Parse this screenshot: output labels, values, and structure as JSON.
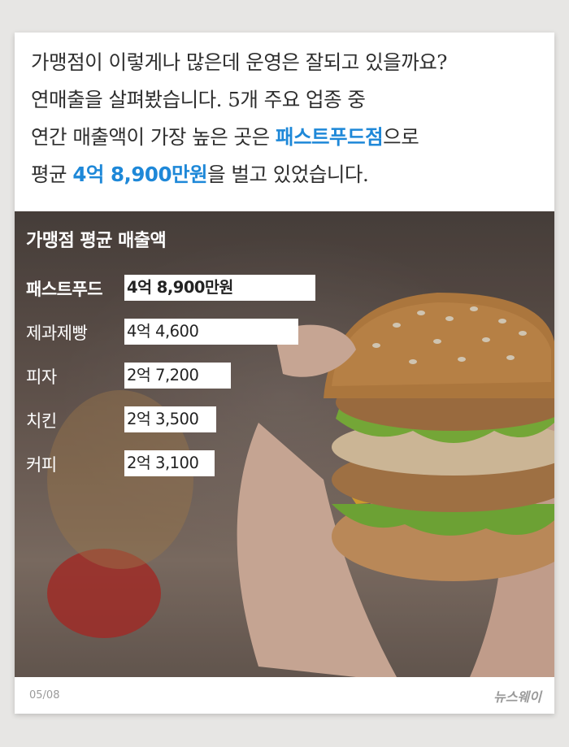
{
  "intro": {
    "line1": "가맹점이 이렇게나 많은데 운영은 잘되고 있을까요?",
    "line2": "연매출을 살펴봤습니다. 5개 주요 업종 중",
    "line3_pre": "연간 매출액이 가장 높은 곳은 ",
    "line3_highlight": "패스트푸드점",
    "line3_post": "으로",
    "line4_pre": "평균 ",
    "line4_highlight": "4억 8,900만원",
    "line4_post": "을 벌고 있었습니다."
  },
  "colors": {
    "highlight": "#1e88d8",
    "bar": "#ffffff",
    "title": "#ffffff"
  },
  "chart_data": {
    "type": "bar",
    "title": "가맹점 평균 매출액",
    "unit": "만원",
    "categories": [
      "패스트푸드",
      "제과제빵",
      "피자",
      "치킨",
      "커피"
    ],
    "values": [
      48900,
      44600,
      27200,
      23500,
      23100
    ],
    "labels": [
      "4억 8,900만원",
      "4억 4,600",
      "2억 7,200",
      "2억 3,500",
      "2억 3,100"
    ]
  },
  "footer": {
    "page": "05/08",
    "brand": "뉴스웨이"
  }
}
